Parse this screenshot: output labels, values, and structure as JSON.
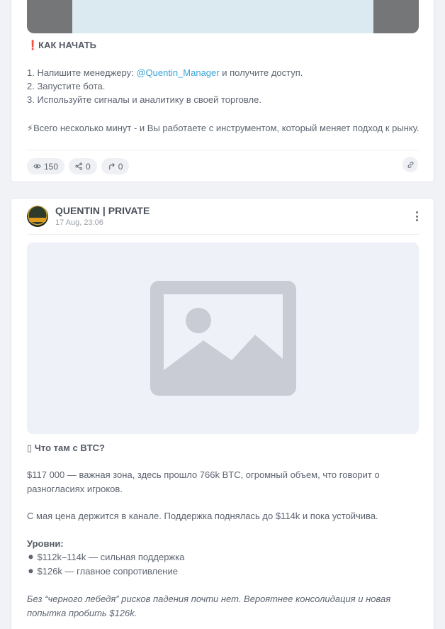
{
  "post1": {
    "heading": "❗КАК НАЧАТЬ",
    "step1_prefix": "1. Напишите менеджеру: ",
    "step1_link": "@Quentin_Manager",
    "step1_suffix": " и получите доступ.",
    "step2": "2. Запустите бота.",
    "step3": "3. Используйте сигналы и аналитику в своей торговле.",
    "closing": "⚡Всего несколько минут - и Вы работаете с инструментом, который меняет подход к рынку.",
    "stats": {
      "views": "150",
      "shares": "0",
      "forwards": "0"
    }
  },
  "post2": {
    "channel": "QUENTIN | PRIVATE",
    "date": "17 Aug, 23:06",
    "heading": "▯ Что там с BTC?",
    "para1": "$117 000 — важная зона, здесь прошло 766k BTC, огромный объем, что говорит о разногласиях игроков.",
    "para2": "С мая цена держится в канале. Поддержка поднялась до $114k и пока устойчива.",
    "levels_title": "Уровни:",
    "level1": "⚫ $112k–114k — сильная поддержка",
    "level2": "⚫ $126k — главное сопротивление",
    "italic_note": "Без “черного лебедя” рисков падения почти нет. Вероятнее консолидация и новая попытка пробить $126k."
  },
  "colors": {
    "page_bg": "#f1f2f6",
    "card_bg": "#ffffff",
    "link": "#3aa3d6",
    "text": "#5d6470",
    "placeholder_bg": "#eef1f8",
    "placeholder_icon": "#c9ccd4"
  },
  "icons": [
    "eye-icon",
    "share-icon",
    "forward-icon",
    "link-icon",
    "more-vertical-icon",
    "image-placeholder-icon",
    "channel-avatar"
  ]
}
